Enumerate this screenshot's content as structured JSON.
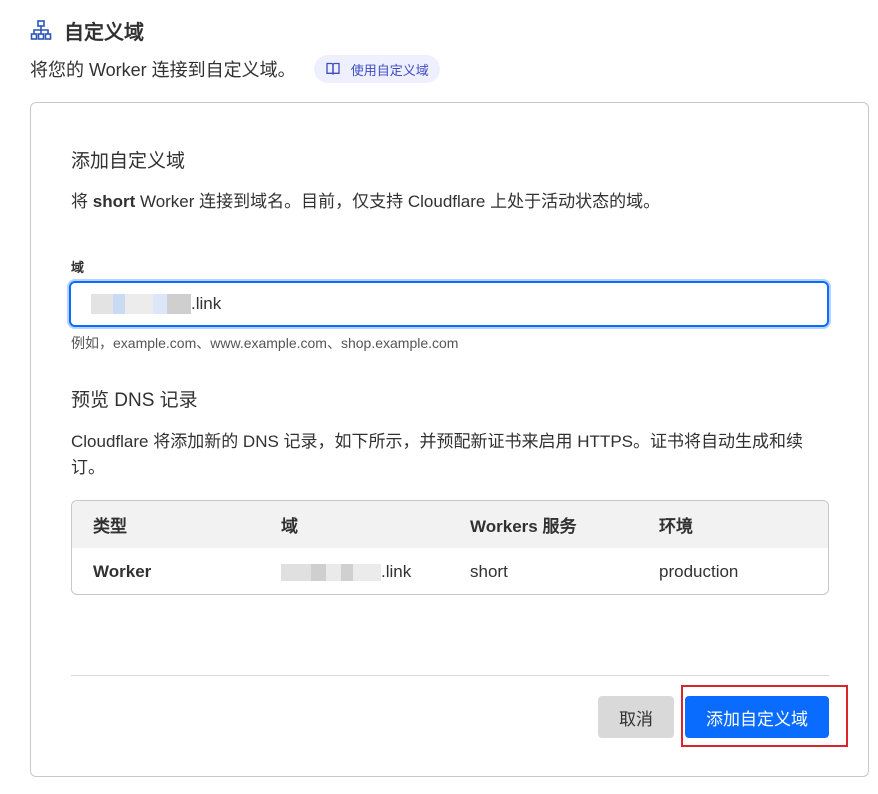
{
  "header": {
    "title": "自定义域",
    "subtitle": "将您的 Worker 连接到自定义域。",
    "docs_link": "使用自定义域",
    "icon": "sitemap-icon"
  },
  "card": {
    "title": "添加自定义域",
    "desc_prefix": "将 ",
    "desc_worker": "short",
    "desc_suffix": " Worker 连接到域名。目前，仅支持 Cloudflare 上处于活动状态的域。",
    "field_label": "域",
    "input_value_suffix": ".link",
    "hint": "例如，example.com、www.example.com、shop.example.com",
    "dns_title": "预览 DNS 记录",
    "dns_desc": "Cloudflare 将添加新的 DNS 记录，如下所示，并预配新证书来启用 HTTPS。证书将自动生成和续订。",
    "table": {
      "headers": [
        "类型",
        "域",
        "Workers 服务",
        "环境"
      ],
      "row": {
        "type": "Worker",
        "domain_suffix": ".link",
        "service": "short",
        "environment": "production"
      }
    },
    "cancel_label": "取消",
    "submit_label": "添加自定义域"
  },
  "colors": {
    "primary": "#0a6cff",
    "highlight": "#d9252b",
    "pill_bg": "#eef0ff",
    "pill_text": "#3e4bc2"
  }
}
